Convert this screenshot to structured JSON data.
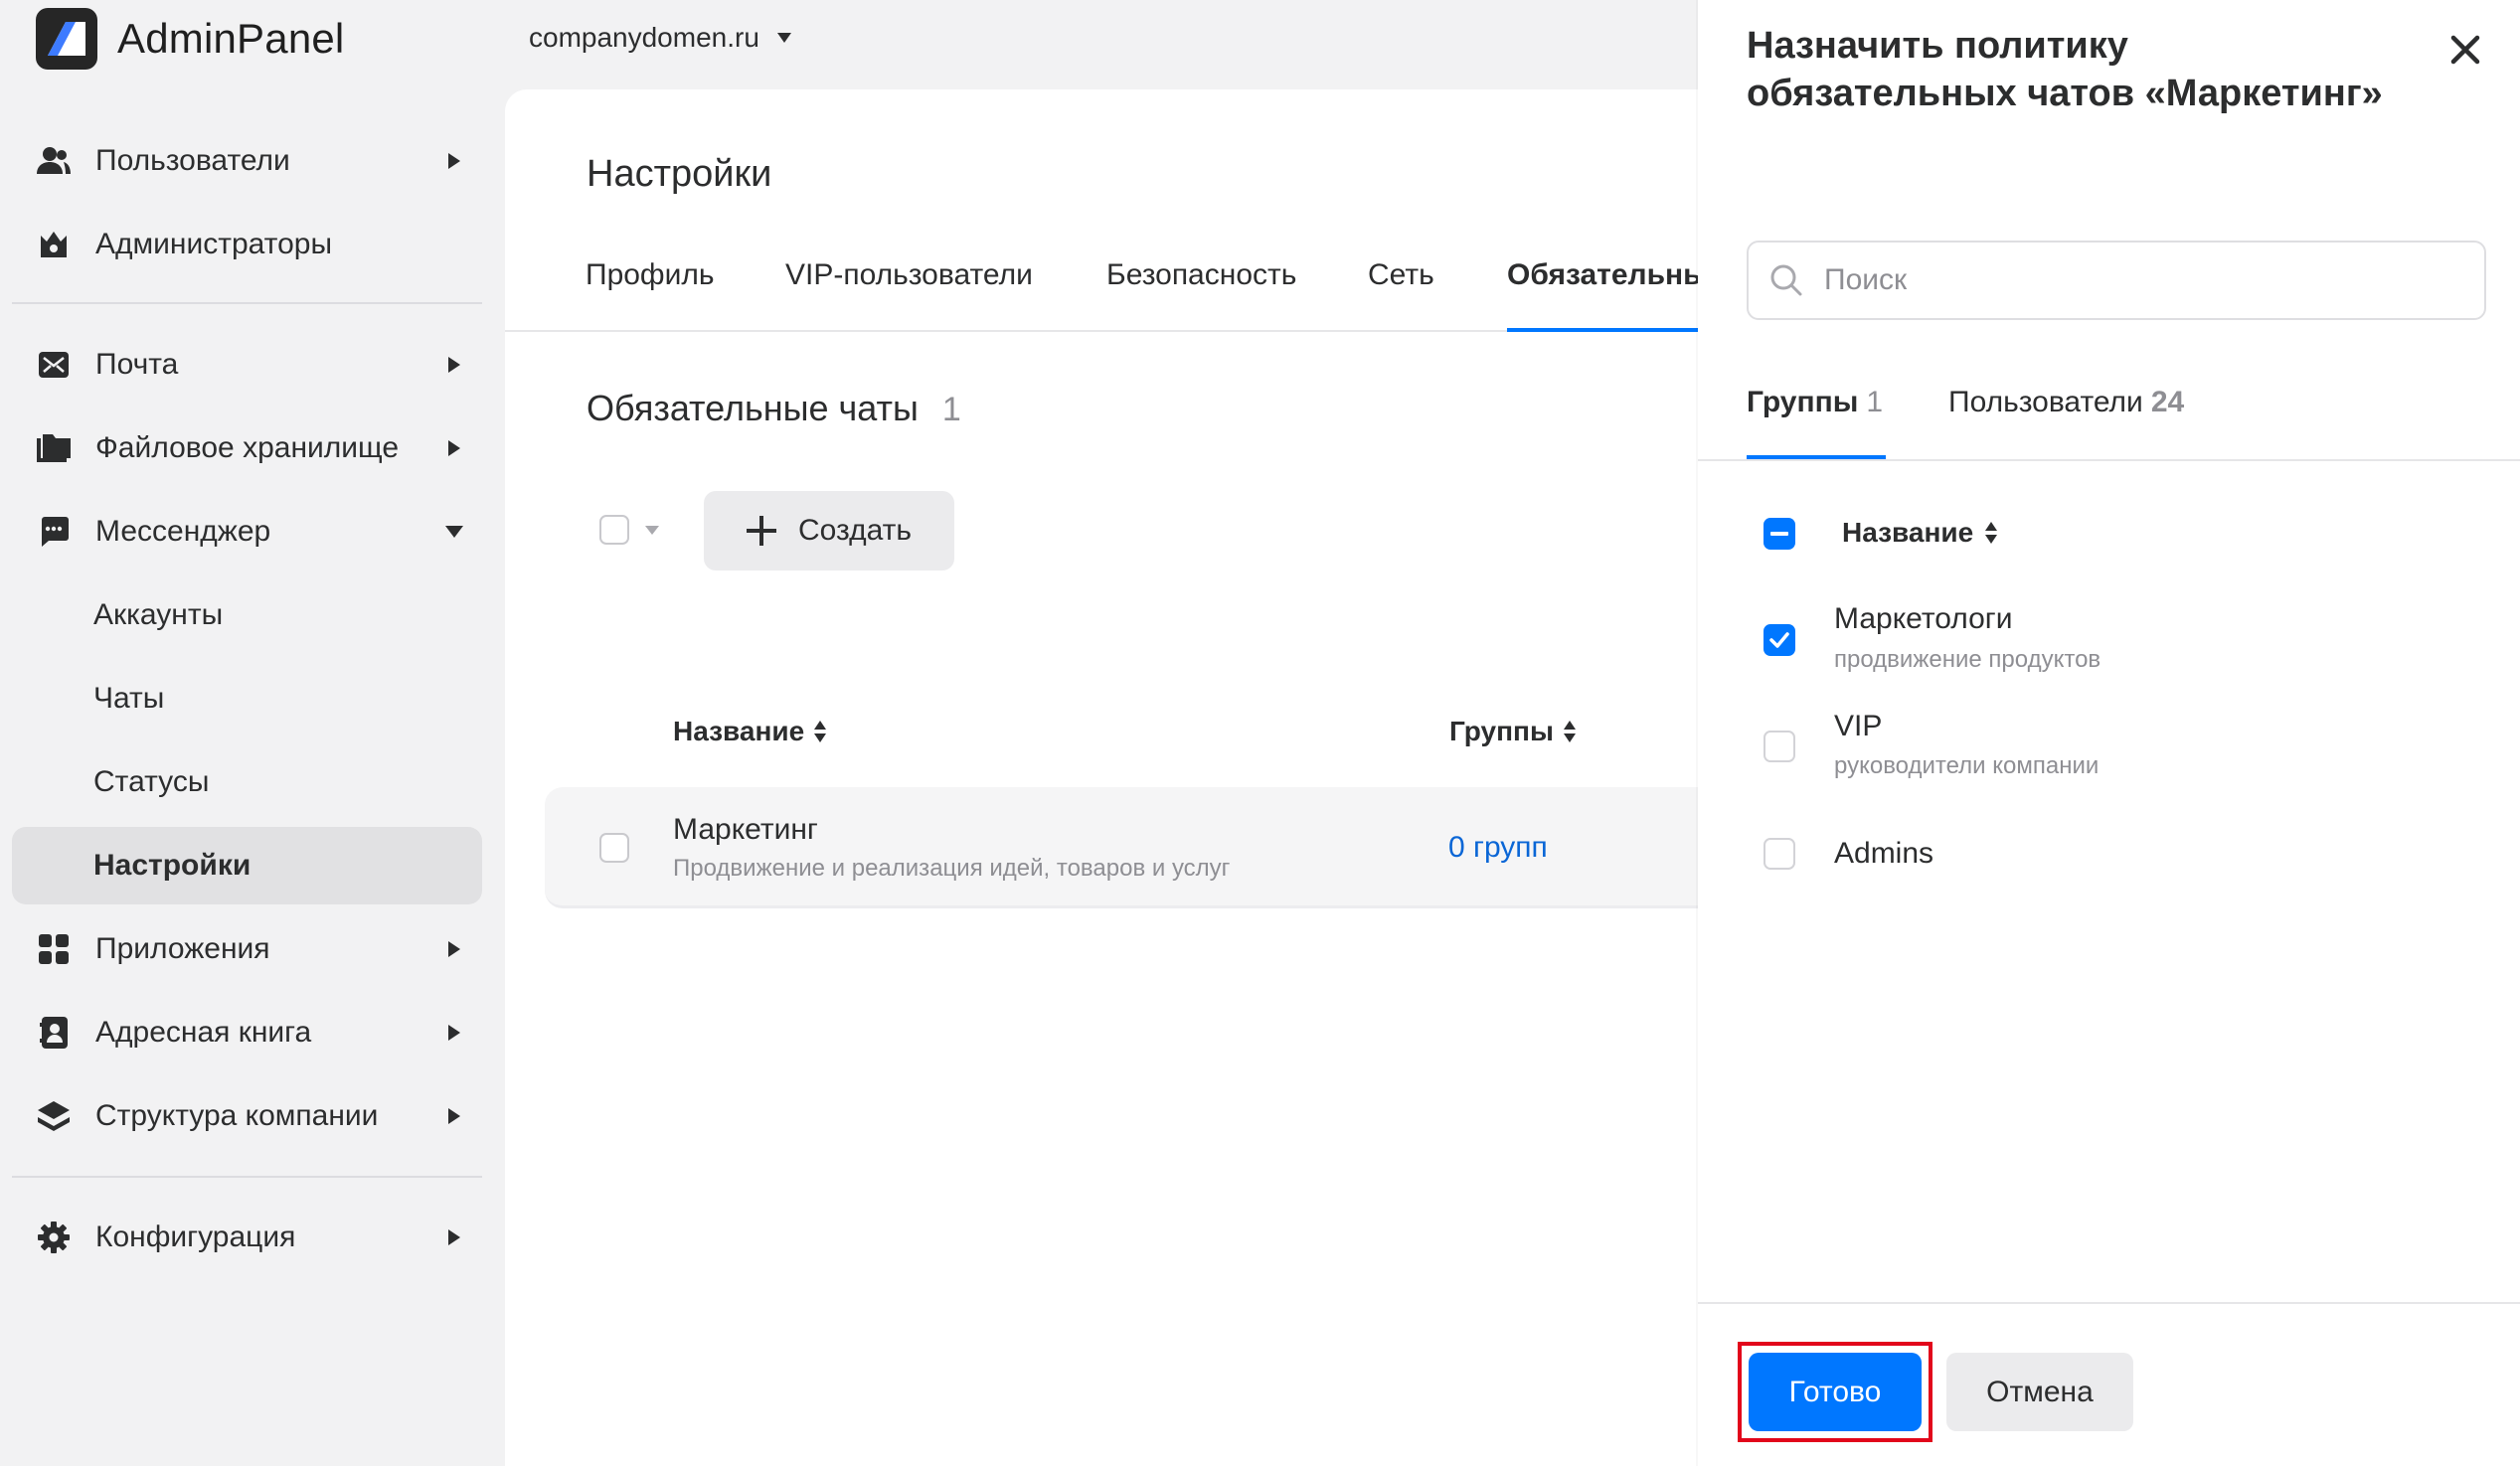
{
  "app": {
    "name": "AdminPanel",
    "domain": "companydomen.ru",
    "accent_color": "#0077ff",
    "link_color": "#0a66d6"
  },
  "sidebar": {
    "items": [
      {
        "label": "Пользователи",
        "icon": "users-icon",
        "caret": "right"
      },
      {
        "label": "Администраторы",
        "icon": "admin-crown-icon",
        "caret": ""
      },
      {
        "label": "Почта",
        "icon": "mail-icon",
        "caret": "right"
      },
      {
        "label": "Файловое хранилище",
        "icon": "folder-icon",
        "caret": "right"
      },
      {
        "label": "Мессенджер",
        "icon": "chat-icon",
        "caret": "down"
      },
      {
        "label": "Аккаунты",
        "icon": "",
        "caret": ""
      },
      {
        "label": "Чаты",
        "icon": "",
        "caret": ""
      },
      {
        "label": "Статусы",
        "icon": "",
        "caret": ""
      },
      {
        "label": "Настройки",
        "icon": "",
        "caret": "",
        "active": true
      },
      {
        "label": "Приложения",
        "icon": "apps-grid-icon",
        "caret": "right"
      },
      {
        "label": "Адресная книга",
        "icon": "address-book-icon",
        "caret": "right"
      },
      {
        "label": "Структура компании",
        "icon": "layers-icon",
        "caret": "right"
      },
      {
        "label": "Конфигурация",
        "icon": "gear-icon",
        "caret": "right"
      }
    ]
  },
  "main": {
    "title": "Настройки",
    "tabs": [
      {
        "label": "Профиль"
      },
      {
        "label": "VIP-пользователи"
      },
      {
        "label": "Безопасность"
      },
      {
        "label": "Сеть"
      },
      {
        "label": "Обязательны",
        "active": true
      }
    ],
    "section": {
      "title": "Обязательные чаты",
      "count": "1"
    },
    "create_label": "Создать",
    "columns": {
      "name": "Название",
      "groups": "Группы"
    },
    "rows": [
      {
        "title": "Маркетинг",
        "description": "Продвижение и реализация идей, товаров и услуг",
        "groups_link": "0 групп"
      }
    ]
  },
  "drawer": {
    "title": "Назначить политику обязательных чатов «Маркетинг»",
    "search_placeholder": "Поиск",
    "tabs": [
      {
        "label": "Группы",
        "count": "1",
        "active": true
      },
      {
        "label": "Пользователи",
        "count": "24"
      }
    ],
    "list_header": "Название",
    "groups": [
      {
        "title": "Маркетологи",
        "description": "продвижение продуктов",
        "checked": true
      },
      {
        "title": "VIP",
        "description": "руководители компании",
        "checked": false
      },
      {
        "title": "Admins",
        "description": "",
        "checked": false
      }
    ],
    "done_label": "Готово",
    "cancel_label": "Отмена",
    "highlight_color": "#e2061b"
  }
}
